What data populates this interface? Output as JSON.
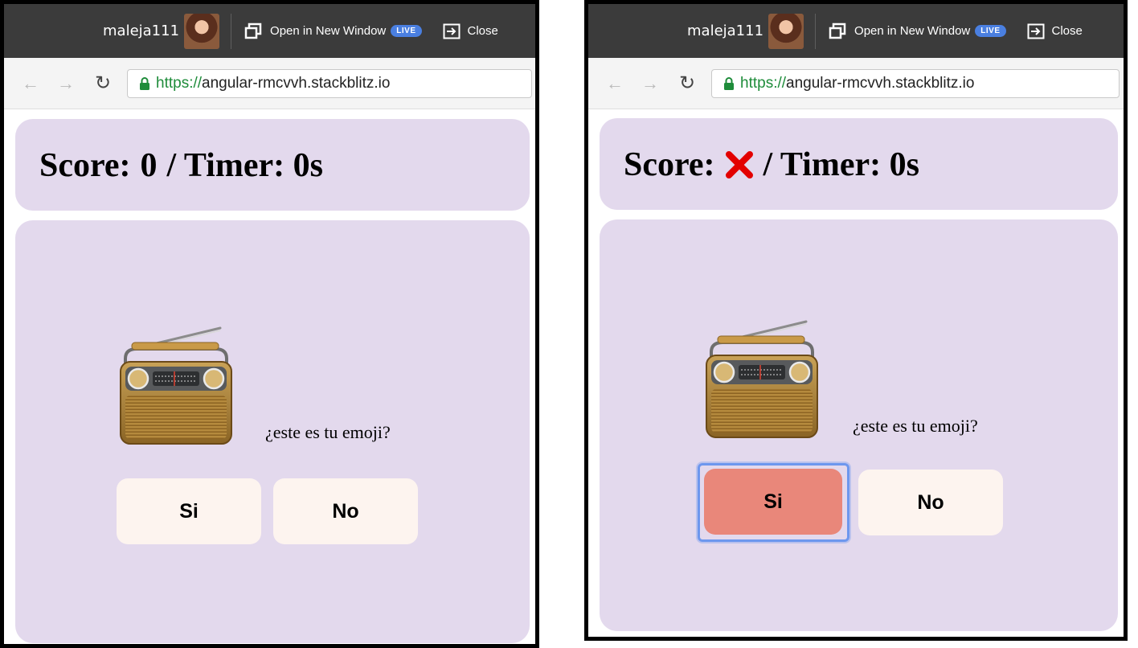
{
  "panels": [
    {
      "topbar": {
        "username": "maleja111",
        "open_window_label": "Open in New Window",
        "live_badge": "LIVE",
        "close_label": "Close"
      },
      "address": {
        "scheme": "https://",
        "host": "angular-rmcvvh.stackblitz.io"
      },
      "score": {
        "prefix": "Score:",
        "value": "0",
        "suffix": "/ Timer: 0s"
      },
      "emoji": "radio",
      "question": "¿este es tu emoji?",
      "buttons": {
        "yes": "Si",
        "no": "No"
      }
    },
    {
      "topbar": {
        "username": "maleja111",
        "open_window_label": "Open in New Window",
        "live_badge": "LIVE",
        "close_label": "Close"
      },
      "address": {
        "scheme": "https://",
        "host": "angular-rmcvvh.stackblitz.io"
      },
      "score": {
        "prefix": "Score:",
        "value_icon": "red-x-icon",
        "suffix": "/ Timer: 0s"
      },
      "emoji": "radio",
      "question": "¿este es tu emoji?",
      "buttons": {
        "yes": "Si",
        "no": "No"
      },
      "yes_state": "wrong"
    }
  ],
  "colors": {
    "topbar": "#3b3b3b",
    "card": "#e3d9ed",
    "button": "#fdf4ef",
    "wrong_button": "#e9877a",
    "live_badge": "#4a7fe0",
    "secure_scheme": "#1e8c3a",
    "x_mark": "#e30000",
    "focus_ring": "#6d97ee"
  }
}
